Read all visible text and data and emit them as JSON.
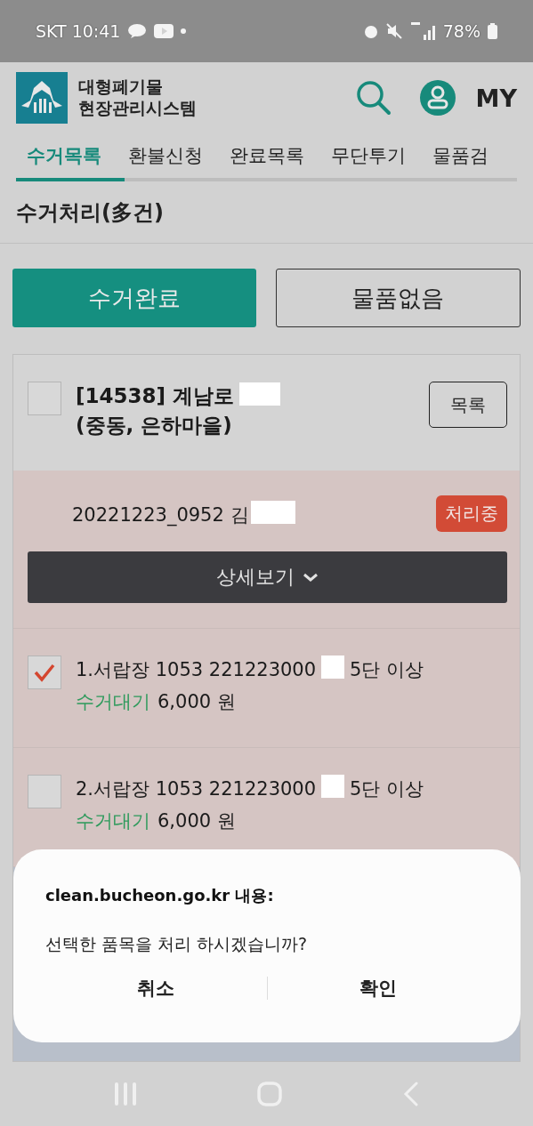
{
  "status_bar": {
    "carrier_time": "SKT 10:41",
    "battery": "78%"
  },
  "header": {
    "title_line1": "대형폐기물",
    "title_line2": "현장관리시스템",
    "my": "MY"
  },
  "tabs": [
    {
      "label": "수거목록",
      "selected": true
    },
    {
      "label": "환불신청",
      "selected": false
    },
    {
      "label": "완료목록",
      "selected": false
    },
    {
      "label": "무단투기",
      "selected": false
    },
    {
      "label": "물품검",
      "selected": false
    }
  ],
  "page_title": "수거처리(多건)",
  "actions": [
    {
      "label": "수거완료",
      "kind": "primary"
    },
    {
      "label": "물품없음",
      "kind": "outline"
    }
  ],
  "group": {
    "checked": false,
    "address_start": "[14538] 계남로",
    "address_end": "(중동, 은하마을)",
    "list_button": "목록",
    "order": {
      "number": "20221223_0952 김",
      "badge": "처리중",
      "detail_button": "상세보기"
    },
    "items": [
      {
        "checked": true,
        "text_start": "1.서랍장 1053 221223000",
        "text_end": "5단 이상",
        "status": "수거대기",
        "price": "6,000 원"
      },
      {
        "checked": false,
        "text_start": "2.서랍장 1053 221223000",
        "text_end": "5단 이상",
        "status": "수거대기",
        "price": "6,000 원"
      }
    ]
  },
  "dialog": {
    "origin": "clean.bucheon.go.kr 내용:",
    "message": "선택한 품목을 처리 하시겠습니까?",
    "buttons": [
      {
        "label": "취소"
      },
      {
        "label": "확인"
      }
    ]
  }
}
